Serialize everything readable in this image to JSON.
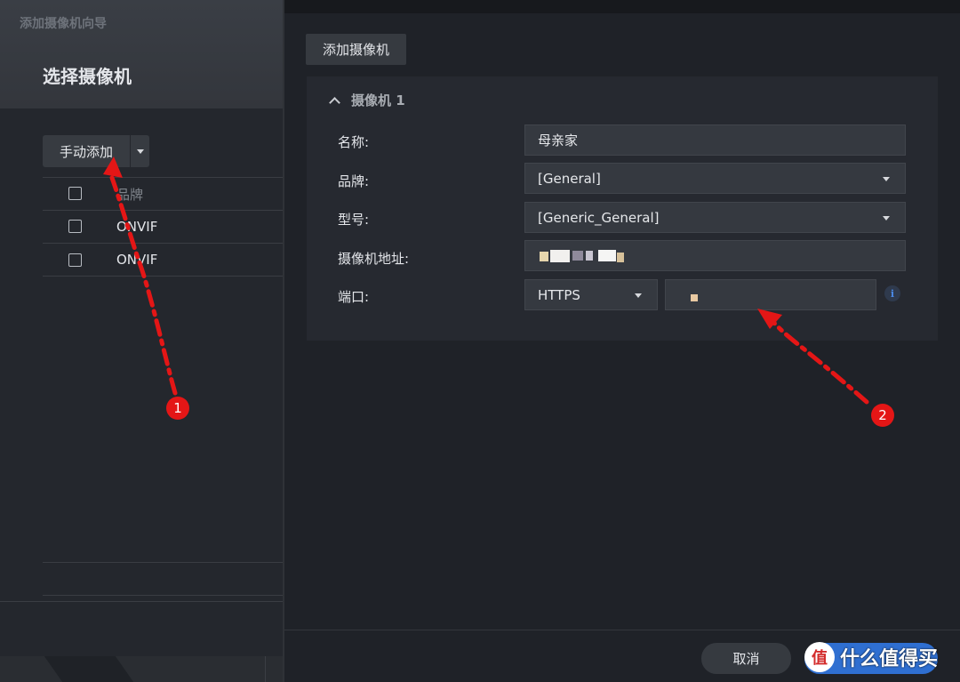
{
  "wizard": {
    "title": "添加摄像机向导",
    "step_title": "选择摄像机",
    "add_button": "手动添加",
    "table": {
      "header": "品牌",
      "rows": [
        "ONVIF",
        "ONVIF"
      ]
    }
  },
  "form": {
    "tab": "添加摄像机",
    "section_title": "摄像机 1",
    "fields": {
      "name_label": "名称:",
      "name_value": "母亲家",
      "brand_label": "品牌:",
      "brand_value": "[General]",
      "model_label": "型号:",
      "model_value": "[Generic_General]",
      "address_label": "摄像机地址:",
      "port_label": "端口:",
      "protocol_value": "HTTPS"
    },
    "info_glyph": "i"
  },
  "footer": {
    "cancel": "取消"
  },
  "annotations": {
    "badge1": "1",
    "badge2": "2",
    "arrow_color": "#e41616"
  },
  "watermark": {
    "logo": "值",
    "text": "什么值得买"
  }
}
